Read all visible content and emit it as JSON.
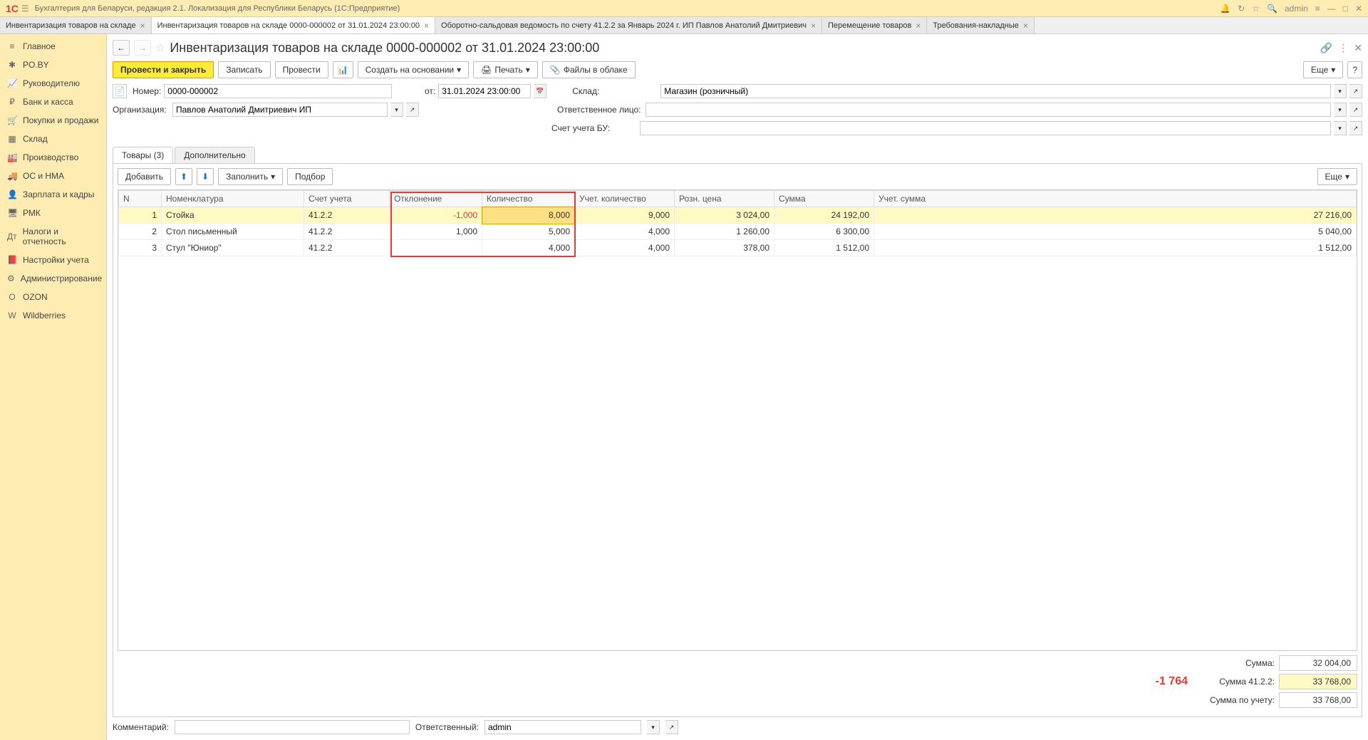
{
  "titlebar": {
    "app_title": "Бухгалтерия для Беларуси, редакция 2.1. Локализация для Республики Беларусь   (1С:Предприятие)",
    "user": "admin"
  },
  "tabs": [
    {
      "label": "Инвентаризация товаров на складе",
      "active": false
    },
    {
      "label": "Инвентаризация товаров на складе 0000-000002 от 31.01.2024 23:00:00",
      "active": true
    },
    {
      "label": "Оборотно-сальдовая ведомость по счету 41.2.2 за Январь 2024 г. ИП Павлов Анатолий Дмитриевич",
      "active": false
    },
    {
      "label": "Перемещение товаров",
      "active": false
    },
    {
      "label": "Требования-накладные",
      "active": false
    }
  ],
  "sidebar": [
    {
      "label": "Главное",
      "icon": "≡"
    },
    {
      "label": "PO.BY",
      "icon": "✱"
    },
    {
      "label": "Руководителю",
      "icon": "📈"
    },
    {
      "label": "Банк и касса",
      "icon": "₽"
    },
    {
      "label": "Покупки и продажи",
      "icon": "🛒"
    },
    {
      "label": "Склад",
      "icon": "▦"
    },
    {
      "label": "Производство",
      "icon": "🏭"
    },
    {
      "label": "ОС и НМА",
      "icon": "🚚"
    },
    {
      "label": "Зарплата и кадры",
      "icon": "👤"
    },
    {
      "label": "РМК",
      "icon": "🖥"
    },
    {
      "label": "Налоги и отчетность",
      "icon": "Дт"
    },
    {
      "label": "Настройки учета",
      "icon": "📕"
    },
    {
      "label": "Администрирование",
      "icon": "⚙"
    },
    {
      "label": "OZON",
      "icon": "O"
    },
    {
      "label": "Wildberries",
      "icon": "W"
    }
  ],
  "doc": {
    "title": "Инвентаризация товаров на складе 0000-000002 от 31.01.2024 23:00:00",
    "toolbar": {
      "post_close": "Провести и закрыть",
      "save": "Записать",
      "post": "Провести",
      "create_based": "Создать на основании",
      "print": "Печать",
      "cloud": "Файлы в облаке",
      "more": "Еще"
    },
    "fields": {
      "number_label": "Номер:",
      "number": "0000-000002",
      "date_label": "от:",
      "date": "31.01.2024 23:00:00",
      "org_label": "Организация:",
      "org": "Павлов Анатолий Дмитриевич ИП",
      "warehouse_label": "Склад:",
      "warehouse": "Магазин (розничный)",
      "responsible_label": "Ответственное лицо:",
      "responsible": "",
      "account_label": "Счет учета БУ:",
      "account": ""
    },
    "doc_tabs": {
      "goods": "Товары (3)",
      "extra": "Дополнительно"
    },
    "table_toolbar": {
      "add": "Добавить",
      "fill": "Заполнить",
      "pick": "Подбор",
      "more": "Еще"
    },
    "columns": {
      "n": "N",
      "item": "Номенклатура",
      "acct": "Счет учета",
      "dev": "Отклонение",
      "qty": "Количество",
      "acc_qty": "Учет. количество",
      "price": "Розн. цена",
      "sum": "Сумма",
      "acc_sum": "Учет. сумма"
    },
    "rows": [
      {
        "n": "1",
        "item": "Стойка",
        "acct": "41.2.2",
        "dev": "-1,000",
        "qty": "8,000",
        "acc_qty": "9,000",
        "price": "3 024,00",
        "sum": "24 192,00",
        "acc_sum": "27 216,00",
        "neg": true,
        "selected": true
      },
      {
        "n": "2",
        "item": "Стол письменный",
        "acct": "41.2.2",
        "dev": "1,000",
        "qty": "5,000",
        "acc_qty": "4,000",
        "price": "1 260,00",
        "sum": "6 300,00",
        "acc_sum": "5 040,00"
      },
      {
        "n": "3",
        "item": "Стул \"Юниор\"",
        "acct": "41.2.2",
        "dev": "",
        "qty": "4,000",
        "acc_qty": "4,000",
        "price": "378,00",
        "sum": "1 512,00",
        "acc_sum": "1 512,00"
      }
    ],
    "totals": {
      "deviation": "-1 764",
      "sum_label": "Сумма:",
      "sum": "32 004,00",
      "sum_acct_label": "Сумма 41.2.2:",
      "sum_acct": "33 768,00",
      "sum_acc_label": "Сумма по учету:",
      "sum_acc": "33 768,00"
    },
    "footer": {
      "comment_label": "Комментарий:",
      "comment": "",
      "resp_label": "Ответственный:",
      "resp": "admin"
    }
  }
}
